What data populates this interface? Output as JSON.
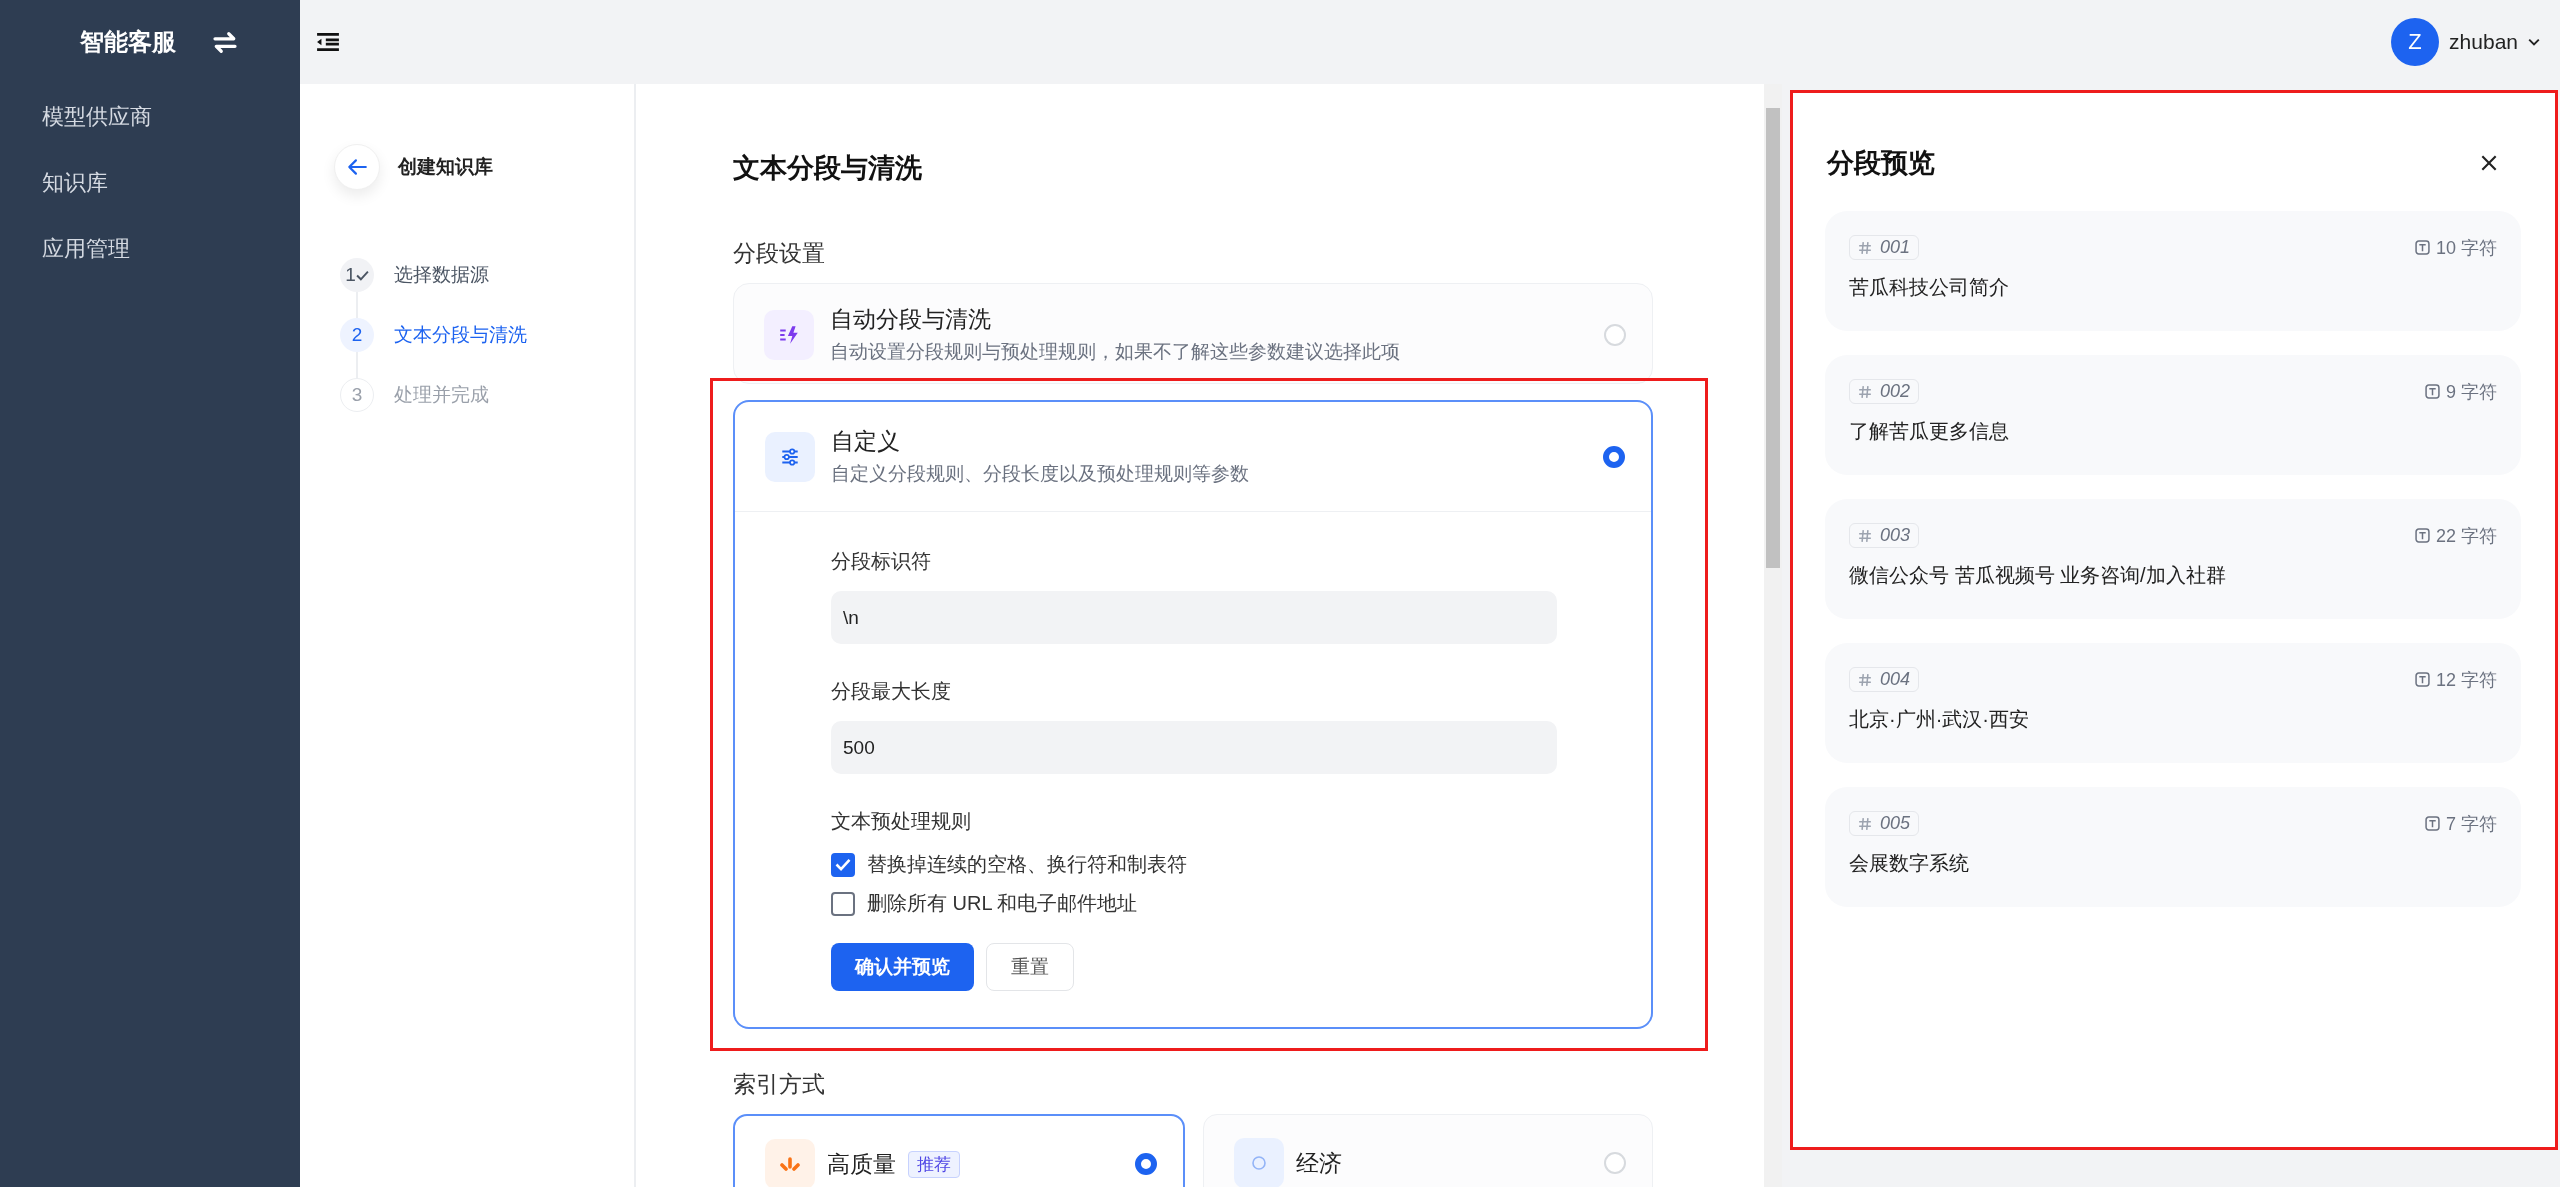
{
  "sidebar": {
    "brand": "智能客服",
    "items": [
      {
        "label": "模型供应商",
        "selected": false
      },
      {
        "label": "知识库",
        "selected": false
      },
      {
        "label": "应用管理",
        "selected": false
      }
    ]
  },
  "header": {
    "user": {
      "avatar": "Z",
      "name": "zhuban"
    }
  },
  "steps_panel": {
    "title": "创建知识库",
    "steps": [
      {
        "number": "1",
        "label": "选择数据源",
        "completed": true,
        "selected": false
      },
      {
        "number": "2",
        "label": "文本分段与清洗",
        "completed": false,
        "selected": true
      },
      {
        "number": "3",
        "label": "处理并完成",
        "completed": false,
        "selected": false
      }
    ]
  },
  "main": {
    "title": "文本分段与清洗",
    "segment_section": {
      "label": "分段设置",
      "options": [
        {
          "kind": "auto",
          "title": "自动分段与清洗",
          "description": "自动设置分段规则与预处理规则，如果不了解这些参数建议选择此项",
          "selected": false
        },
        {
          "kind": "custom",
          "title": "自定义",
          "description": "自定义分段规则、分段长度以及预处理规则等参数",
          "selected": true
        }
      ]
    },
    "custom_settings": {
      "fields": [
        {
          "label": "分段标识符",
          "value": "\\n"
        },
        {
          "label": "分段最大长度",
          "value": "500"
        }
      ],
      "rules_label": "文本预处理规则",
      "rules": [
        {
          "label": "替换掉连续的空格、换行符和制表符",
          "checked": true
        },
        {
          "label": "删除所有 URL 和电子邮件地址",
          "checked": false
        }
      ],
      "buttons": [
        {
          "label": "确认并预览",
          "kind": "primary"
        },
        {
          "label": "重置",
          "kind": "default"
        }
      ]
    },
    "index_section": {
      "label": "索引方式",
      "options": [
        {
          "kind": "quality",
          "title": "高质量",
          "badge": "推荐",
          "selected": true
        },
        {
          "kind": "economy",
          "title": "经济",
          "selected": false
        }
      ]
    }
  },
  "preview": {
    "title": "分段预览",
    "segments": [
      {
        "number": "001",
        "chars": "10 字符",
        "text": "苦瓜科技公司简介"
      },
      {
        "number": "002",
        "chars": "9 字符",
        "text": "了解苦瓜更多信息"
      },
      {
        "number": "003",
        "chars": "22 字符",
        "text": "微信公众号 苦瓜视频号 业务咨询/加入社群"
      },
      {
        "number": "004",
        "chars": "12 字符",
        "text": "北京·广州·武汉·西安"
      },
      {
        "number": "005",
        "chars": "7 字符",
        "text": "会展数字系统"
      }
    ]
  }
}
